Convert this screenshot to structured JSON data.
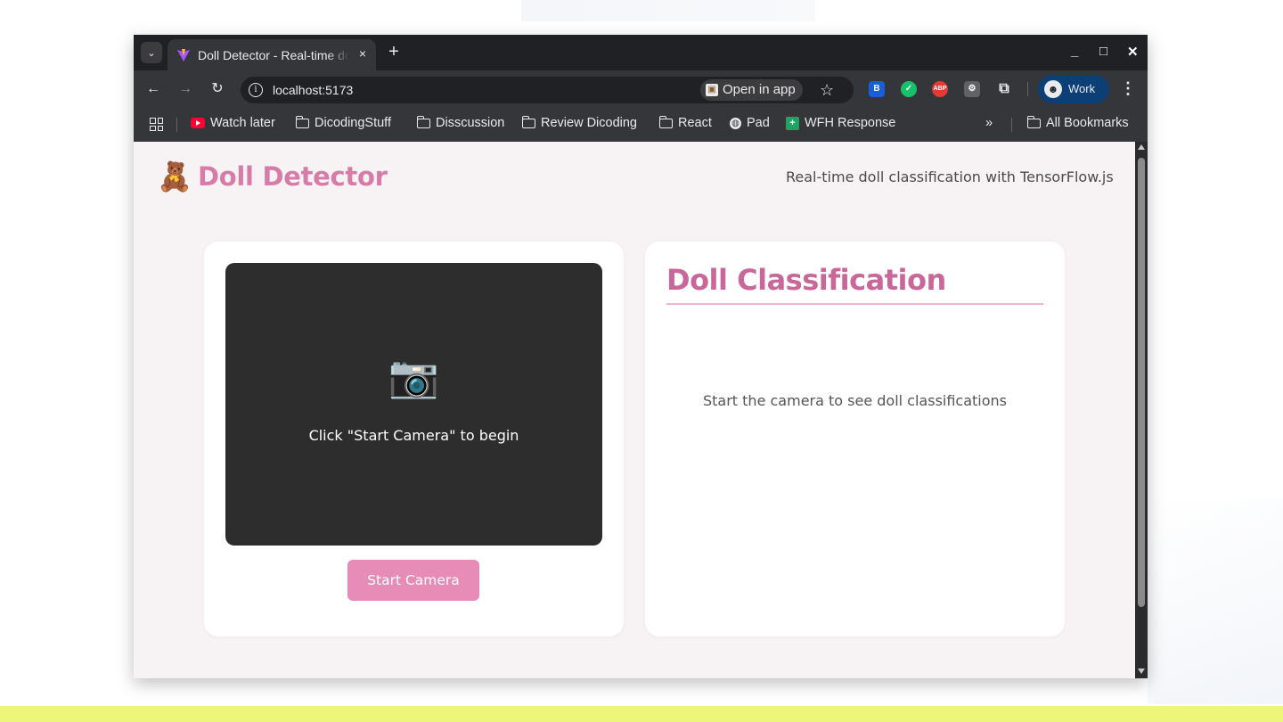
{
  "browser": {
    "tab_title": "Doll Detector - Real-time doll classification with TensorFlow.js",
    "tab_close": "×",
    "new_tab": "+",
    "controls": {
      "minimize": "_",
      "maximize": "□",
      "close": "✕"
    },
    "url": "localhost:5173",
    "open_in_app": "Open in app",
    "profile_label": "Work",
    "extensions": [
      "bitwarden-icon",
      "grammar-check-icon",
      "adblock-plus-icon",
      "extension-puzzle-icon",
      "extensions-menu-icon"
    ],
    "bookmarks": [
      {
        "label": "Watch later",
        "icon": "youtube-icon"
      },
      {
        "label": "DicodingStuff",
        "icon": "folder-icon"
      },
      {
        "label": "Disscussion",
        "icon": "folder-icon"
      },
      {
        "label": "Review Dicoding",
        "icon": "folder-icon"
      },
      {
        "label": "React",
        "icon": "folder-icon"
      },
      {
        "label": "Pad",
        "icon": "globe-icon"
      },
      {
        "label": "WFH Response",
        "icon": "sheets-icon"
      }
    ],
    "overflow": "»",
    "all_bookmarks": "All Bookmarks"
  },
  "app": {
    "logo": "🧸",
    "title": "Doll Detector",
    "subtitle": "Real-time doll classification with TensorFlow.js",
    "camera": {
      "icon": "📷",
      "prompt": "Click \"Start Camera\" to begin",
      "start_button": "Start Camera"
    },
    "classification": {
      "title": "Doll Classification",
      "empty_message": "Start the camera to see doll classifications"
    },
    "colors": {
      "accent": "#d77ca8",
      "button": "#e68cb6",
      "page_bg": "#f7f3f5",
      "video_bg": "#2d2d2d"
    }
  }
}
